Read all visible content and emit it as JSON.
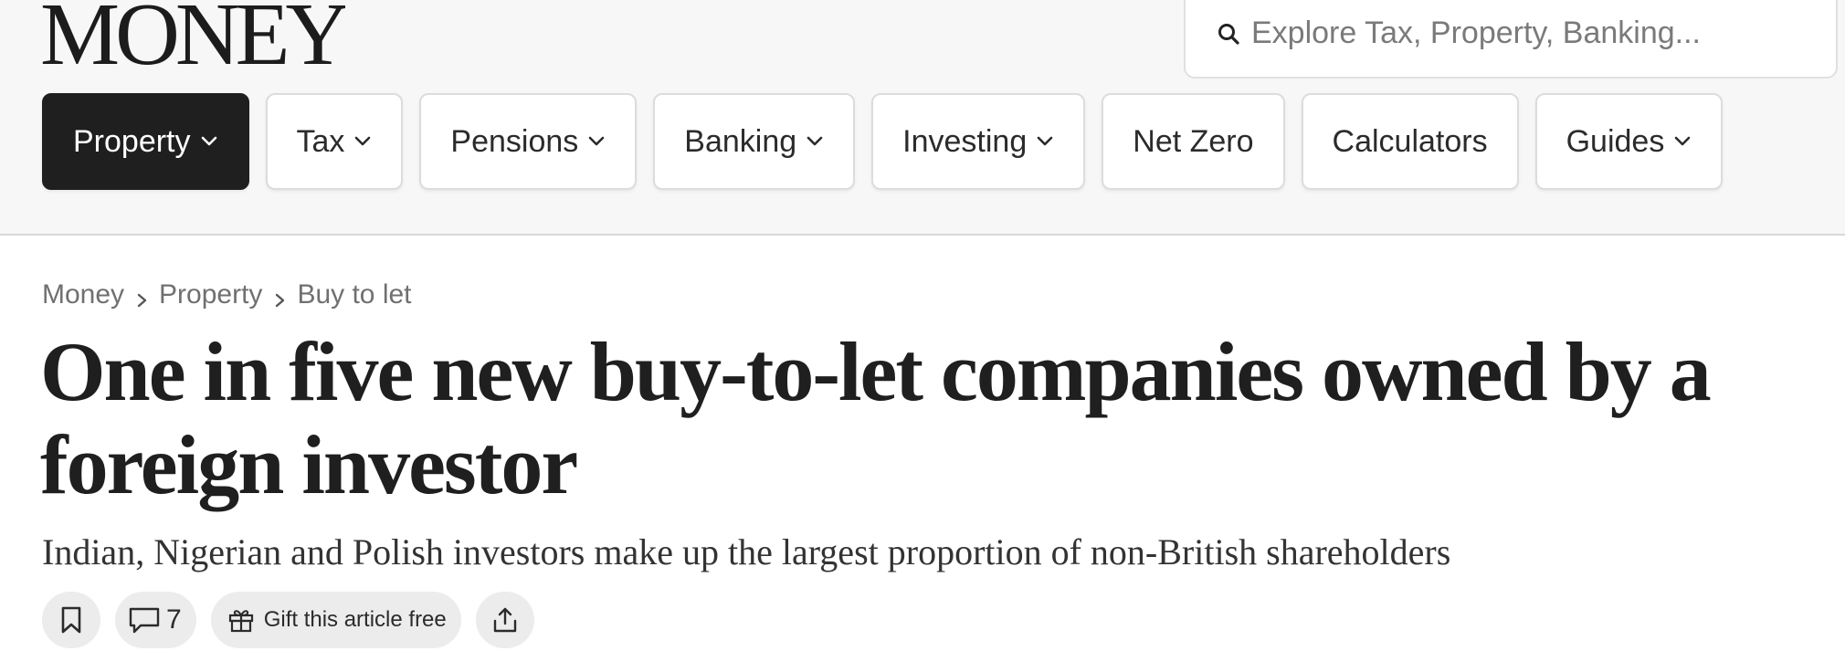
{
  "brand": {
    "logo": "MONEY"
  },
  "search": {
    "placeholder": "Explore Tax, Property, Banking...",
    "icon": "search-icon"
  },
  "nav": {
    "items": [
      {
        "label": "Property",
        "has_dropdown": true,
        "active": true
      },
      {
        "label": "Tax",
        "has_dropdown": true,
        "active": false
      },
      {
        "label": "Pensions",
        "has_dropdown": true,
        "active": false
      },
      {
        "label": "Banking",
        "has_dropdown": true,
        "active": false
      },
      {
        "label": "Investing",
        "has_dropdown": true,
        "active": false
      },
      {
        "label": "Net Zero",
        "has_dropdown": false,
        "active": false
      },
      {
        "label": "Calculators",
        "has_dropdown": false,
        "active": false
      },
      {
        "label": "Guides",
        "has_dropdown": true,
        "active": false
      }
    ]
  },
  "breadcrumb": {
    "items": [
      "Money",
      "Property",
      "Buy to let"
    ]
  },
  "article": {
    "headline": "One in five new buy-to-let companies owned by a foreign investor",
    "standfirst": "Indian, Nigerian and Polish investors make up the largest proportion of non-British shareholders"
  },
  "actions": {
    "comment_count": "7",
    "gift_label": "Gift this article free"
  },
  "colors": {
    "header_bg": "#f7f7f7",
    "active_nav_bg": "#1f1f1f",
    "pill_bg": "#ececec",
    "text_dark": "#1f1f1f",
    "text_muted": "#707070"
  }
}
